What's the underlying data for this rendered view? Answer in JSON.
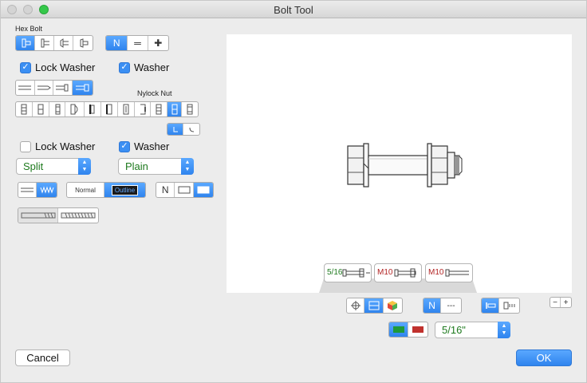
{
  "window": {
    "title": "Bolt Tool"
  },
  "head": {
    "label": "Hex Bolt",
    "styles": [
      "hex-bolt-front-icon",
      "hex-bolt-side-icon",
      "hex-bolt-angle-icon",
      "hex-bolt-top-icon"
    ],
    "selected": 0
  },
  "view_mode": {
    "options": [
      "N",
      "═",
      "✚"
    ],
    "selected": 0
  },
  "top_washers": {
    "lock_washer": {
      "label": "Lock Washer",
      "checked": true
    },
    "washer": {
      "label": "Washer",
      "checked": true
    }
  },
  "nut": {
    "label": "Nylock Nut",
    "types": 10,
    "selected_index": 9
  },
  "bottom_washers": {
    "lock_washer": {
      "label": "Lock Washer",
      "checked": false
    },
    "washer": {
      "label": "Washer",
      "checked": true
    }
  },
  "lock_washer_type": {
    "value": "Split"
  },
  "washer_type": {
    "value": "Plain"
  },
  "thread_style": {
    "selected": 1
  },
  "line_style": {
    "options": [
      "Normal",
      "Outline"
    ],
    "selected": 1
  },
  "fill_style": {
    "options": [
      "N",
      "",
      ""
    ],
    "selected": 2
  },
  "thread_length": {
    "selected": 0
  },
  "presets": [
    {
      "label": "5/16\"",
      "color": "#1e7a1e"
    },
    {
      "label": "M10",
      "color": "#b22222"
    },
    {
      "label": "M10",
      "color": "#b22222"
    }
  ],
  "presets_short": [
    "5/16",
    "M10",
    "M10"
  ],
  "view_tools": {
    "selected": 1
  },
  "axis_mode": {
    "options": [
      "N",
      "---"
    ],
    "selected": 0
  },
  "align_mode": {
    "selected": 0
  },
  "zoom": {
    "minus": "−",
    "plus": "+"
  },
  "unit_colors": {
    "green": "#1e9a3a",
    "red": "#c0312d"
  },
  "size": {
    "value": "5/16\""
  },
  "buttons": {
    "cancel": "Cancel",
    "ok": "OK"
  }
}
